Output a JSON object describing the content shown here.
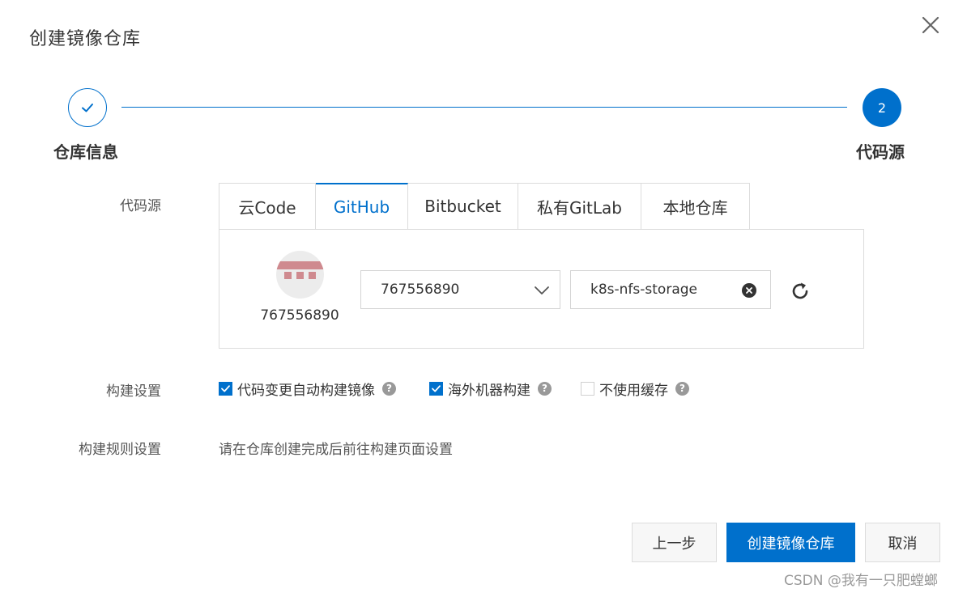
{
  "dialog": {
    "title": "创建镜像仓库",
    "close_icon": "close-icon"
  },
  "steps": [
    {
      "label": "仓库信息",
      "status": "completed",
      "icon": "check-icon"
    },
    {
      "label": "代码源",
      "status": "current",
      "number": "2"
    }
  ],
  "source": {
    "label": "代码源",
    "tabs": [
      {
        "label": "云Code",
        "active": false
      },
      {
        "label": "GitHub",
        "active": true
      },
      {
        "label": "Bitbucket",
        "active": false
      },
      {
        "label": "私有GitLab",
        "active": false
      },
      {
        "label": "本地仓库",
        "active": false
      }
    ],
    "account": {
      "name": "767556890",
      "avatar_icon": "avatar-icon"
    },
    "namespace_select": {
      "value": "767556890",
      "icon": "chevron-down-icon"
    },
    "repo_input": {
      "value": "k8s-nfs-storage",
      "icon": "clear-icon"
    },
    "refresh_icon": "refresh-icon"
  },
  "build_settings": {
    "label": "构建设置",
    "options": [
      {
        "label": "代码变更自动构建镜像",
        "checked": true
      },
      {
        "label": "海外机器构建",
        "checked": true
      },
      {
        "label": "不使用缓存",
        "checked": false
      }
    ],
    "help_glyph": "?"
  },
  "build_rules": {
    "label": "构建规则设置",
    "text": "请在仓库创建完成后前往构建页面设置"
  },
  "footer": {
    "prev_label": "上一步",
    "create_label": "创建镜像仓库",
    "cancel_label": "取消"
  },
  "watermark": "CSDN @我有一只肥螳螂",
  "colors": {
    "accent": "#0070cc",
    "border": "#dcdcdc",
    "text": "#333333"
  }
}
